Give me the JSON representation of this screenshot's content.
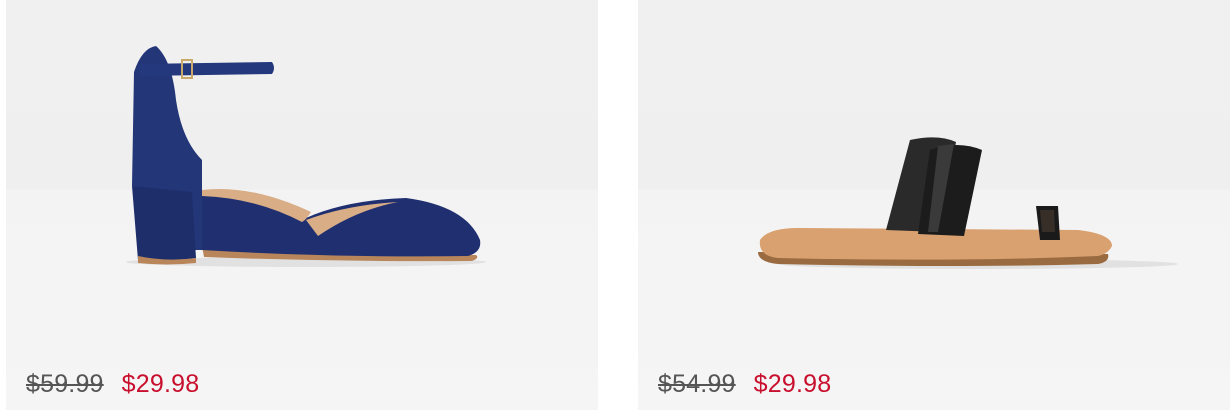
{
  "products": [
    {
      "image_icon": "navy-block-heel-pump-image",
      "original_price": "$59.99",
      "sale_price": "$29.98"
    },
    {
      "image_icon": "black-flat-toe-ring-sandal-image",
      "original_price": "$54.99",
      "sale_price": "$29.98"
    }
  ],
  "colors": {
    "sale_price": "#c8102e",
    "original_price": "#555555",
    "card_background": "#f0f0f0"
  }
}
